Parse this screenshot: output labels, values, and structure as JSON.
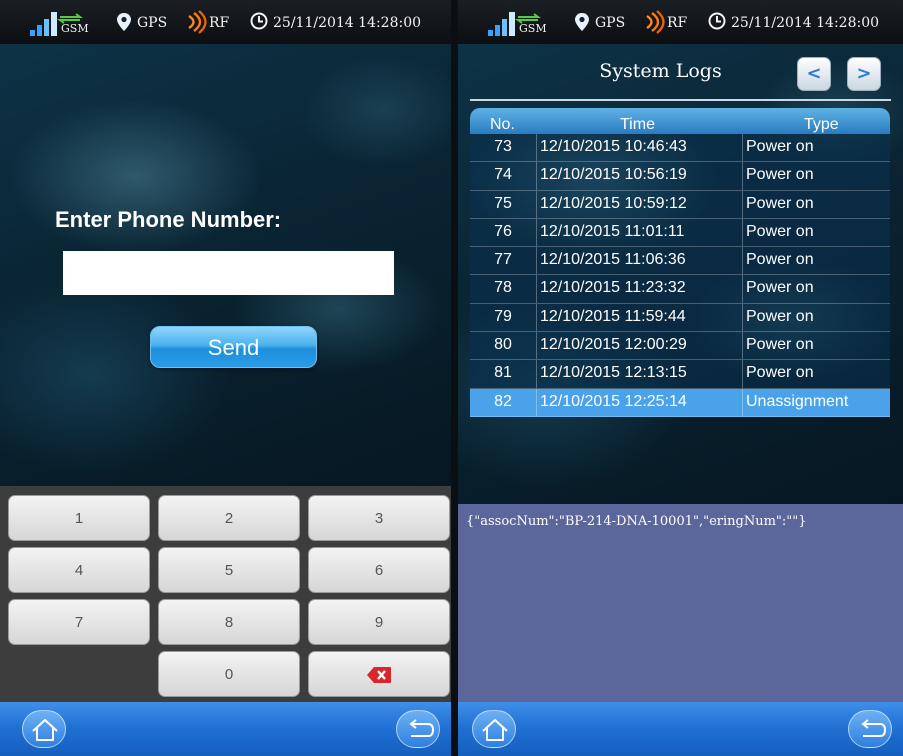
{
  "status": {
    "gsm_label": "GSM",
    "gps_label": "GPS",
    "rf_label": "RF",
    "datetime": "25/11/2014 14:28:00"
  },
  "phone_entry": {
    "prompt": "Enter Phone Number:",
    "value": "",
    "send_label": "Send"
  },
  "keypad": {
    "keys": [
      "1",
      "2",
      "3",
      "4",
      "5",
      "6",
      "7",
      "8",
      "9",
      "0"
    ],
    "delete_icon": "backspace-x-icon"
  },
  "logs": {
    "title": "System Logs",
    "prev_label": "<",
    "next_label": ">",
    "headers": [
      "No.",
      "Time",
      "Type"
    ],
    "rows": [
      {
        "no": "73",
        "time": "12/10/2015 10:46:43",
        "type": "Power on"
      },
      {
        "no": "74",
        "time": "12/10/2015 10:56:19",
        "type": "Power on"
      },
      {
        "no": "75",
        "time": "12/10/2015 10:59:12",
        "type": "Power on"
      },
      {
        "no": "76",
        "time": "12/10/2015 11:01:11",
        "type": "Power on"
      },
      {
        "no": "77",
        "time": "12/10/2015 11:06:36",
        "type": "Power on"
      },
      {
        "no": "78",
        "time": "12/10/2015 11:23:32",
        "type": "Power on"
      },
      {
        "no": "79",
        "time": "12/10/2015 11:59:44",
        "type": "Power on"
      },
      {
        "no": "80",
        "time": "12/10/2015 12:00:29",
        "type": "Power on"
      },
      {
        "no": "81",
        "time": "12/10/2015 12:13:15",
        "type": "Power on"
      },
      {
        "no": "82",
        "time": "12/10/2015 12:25:14",
        "type": "Unassignment"
      }
    ],
    "selected_no": "82",
    "detail": "{\"assocNum\":\"BP-214-DNA-10001\",\"eringNum\":\"\"}"
  },
  "colors": {
    "nav_blue": "#1f6fd2",
    "selected_row": "#4aa3ea",
    "detail_bg": "#5b679b",
    "button_blue": "#2a9be6"
  }
}
